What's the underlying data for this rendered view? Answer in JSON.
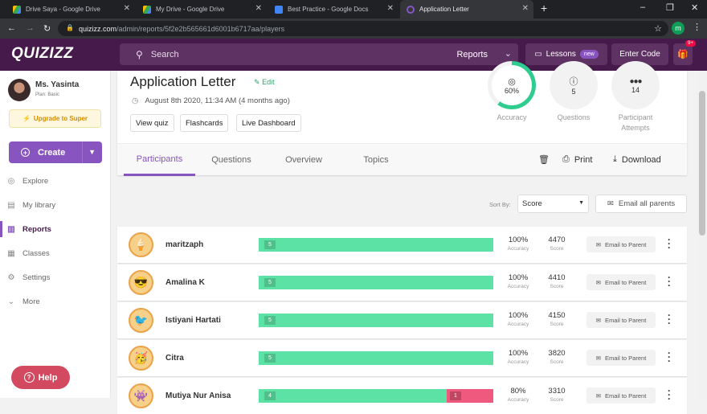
{
  "browser": {
    "tabs": [
      {
        "title": "Drive Saya - Google Drive",
        "icon": "google-drive-icon",
        "active": false
      },
      {
        "title": "My Drive - Google Drive",
        "icon": "google-drive-icon",
        "active": false
      },
      {
        "title": "Best Practice - Google Docs",
        "icon": "google-docs-icon",
        "active": false
      },
      {
        "title": "Application Letter",
        "icon": "quizizz-icon",
        "active": true
      }
    ],
    "url_host": "quizizz.com",
    "url_path": "/admin/reports/5f2e2b565661d6001b6717aa/players",
    "profile_initial": "m"
  },
  "header": {
    "logo": "QUIZIZZ",
    "search_placeholder": "Search",
    "search_scope": "Reports",
    "lessons_label": "Lessons",
    "lessons_badge": "new",
    "enter_code_label": "Enter Code",
    "gift_badge": "9+"
  },
  "sidebar": {
    "user_name": "Ms. Yasinta",
    "plan": "Plan: Basic",
    "upgrade_label": "Upgrade to Super",
    "create_label": "Create",
    "items": [
      {
        "label": "Explore",
        "icon": "compass-icon"
      },
      {
        "label": "My library",
        "icon": "library-icon"
      },
      {
        "label": "Reports",
        "icon": "reports-icon"
      },
      {
        "label": "Classes",
        "icon": "classes-icon"
      },
      {
        "label": "Settings",
        "icon": "gear-icon"
      },
      {
        "label": "More",
        "icon": "chevron-down-icon"
      }
    ],
    "active_item": "Reports",
    "help_label": "Help"
  },
  "report": {
    "title": "Application Letter",
    "edit_label": "Edit",
    "date": "August 8th 2020, 11:34 AM (4 months ago)",
    "buttons": [
      "View quiz",
      "Flashcards",
      "Live Dashboard"
    ],
    "stats": [
      {
        "value": "60%",
        "label": "Accuracy",
        "fraction": 0.6
      },
      {
        "value": "5",
        "label": "Questions"
      },
      {
        "value": "14",
        "label": "Participant Attempts"
      }
    ],
    "tabs": [
      "Participants",
      "Questions",
      "Overview",
      "Topics"
    ],
    "active_tab": "Participants",
    "print_label": "Print",
    "download_label": "Download"
  },
  "sort": {
    "label": "Sort By:",
    "value": "Score",
    "email_all_label": "Email all parents"
  },
  "participants": {
    "accuracy_caption": "Accuracy",
    "score_caption": "Score",
    "email_label": "Email to Parent",
    "rows": [
      {
        "name": "maritzaph",
        "correct": "5",
        "incorrect": "",
        "correct_fraction": 1.0,
        "accuracy": "100%",
        "score": "4470",
        "avatar": "ice-cream-icon"
      },
      {
        "name": "Amalina K",
        "correct": "5",
        "incorrect": "",
        "correct_fraction": 1.0,
        "accuracy": "100%",
        "score": "4410",
        "avatar": "sunglasses-face-icon"
      },
      {
        "name": "Istiyani Hartati",
        "correct": "5",
        "incorrect": "",
        "correct_fraction": 1.0,
        "accuracy": "100%",
        "score": "4150",
        "avatar": "bird-icon"
      },
      {
        "name": "Citra",
        "correct": "5",
        "incorrect": "",
        "correct_fraction": 1.0,
        "accuracy": "100%",
        "score": "3820",
        "avatar": "party-face-icon"
      },
      {
        "name": "Mutiya Nur Anisa",
        "correct": "4",
        "incorrect": "1",
        "correct_fraction": 0.8,
        "accuracy": "80%",
        "score": "3310",
        "avatar": "monster-icon"
      }
    ]
  }
}
